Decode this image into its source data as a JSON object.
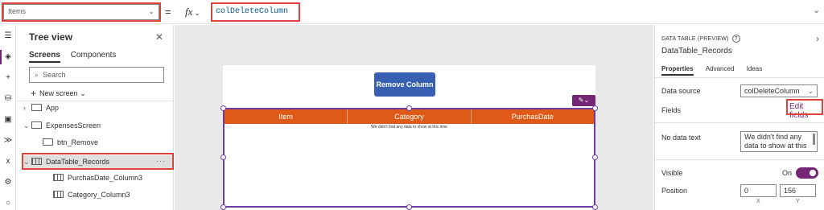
{
  "formula_bar": {
    "property": "Items",
    "equals": "=",
    "fx": "fx",
    "formula": "colDeleteColumn"
  },
  "tree": {
    "title": "Tree view",
    "tabs": [
      "Screens",
      "Components"
    ],
    "search_placeholder": "Search",
    "new_screen": "New screen",
    "nodes": {
      "app": "App",
      "screen": "ExpensesScreen",
      "button": "btn_Remove",
      "table": "DataTable_Records",
      "col1": "PurchasDate_Column3",
      "col2": "Category_Column3"
    }
  },
  "canvas": {
    "button_label": "Remove Column",
    "columns": [
      "Item",
      "Category",
      "PurchasDate"
    ],
    "empty_text": "We didn't find any data to show at this time"
  },
  "properties": {
    "kind": "DATA TABLE (PREVIEW)",
    "name": "DataTable_Records",
    "tabs": [
      "Properties",
      "Advanced",
      "Ideas"
    ],
    "data_source_label": "Data source",
    "data_source_value": "colDeleteColumn",
    "fields_label": "Fields",
    "edit_fields": "Edit fields",
    "no_data_label": "No data text",
    "no_data_value": "We didn't find any data to show at this",
    "visible_label": "Visible",
    "visible_value": "On",
    "position_label": "Position",
    "position_x": "0",
    "position_y": "156",
    "x_label": "X",
    "y_label": "Y"
  },
  "colors": {
    "accent": "#742774",
    "header": "#e05a17",
    "button": "#3860b2",
    "highlight": "#e0423c"
  }
}
